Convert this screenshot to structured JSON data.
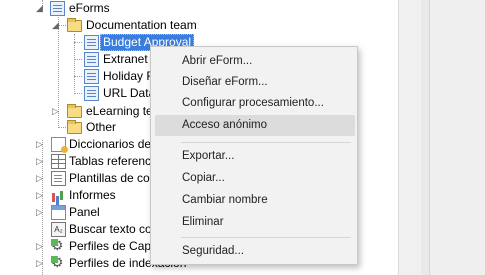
{
  "tree": {
    "eforms": "eForms",
    "documentation_team": "Documentation team",
    "budget_approval": "Budget Approval",
    "extranet": "Extranet a",
    "holiday": "Holiday Re",
    "url_data": "URL Data",
    "elearning": "eLearning tea",
    "other": "Other",
    "diccionarios": "Diccionarios de p",
    "tablas": "Tablas referencia",
    "plantillas": "Plantillas de cons",
    "informes": "Informes",
    "panel": "Panel",
    "buscar": "Buscar texto com",
    "perfiles_captura": "Perfiles de Captur",
    "perfiles_indexacion": "Perfiles de indexación"
  },
  "search_icon_text": "A₂",
  "context_menu": {
    "abrir": "Abrir eForm...",
    "disenar": "Diseñar eForm...",
    "configurar": "Configurar procesamiento...",
    "acceso": "Acceso anónimo",
    "exportar": "Exportar...",
    "copiar": "Copiar...",
    "cambiar": "Cambiar nombre",
    "eliminar": "Eliminar",
    "seguridad": "Seguridad..."
  },
  "colors": {
    "selection": "#3b7ddd",
    "menu_background": "#f2f2f2",
    "menu_hover": "#dcdcdc"
  },
  "hovered_menu_item": "Acceso anónimo",
  "selected_tree_item": "Budget Approval"
}
